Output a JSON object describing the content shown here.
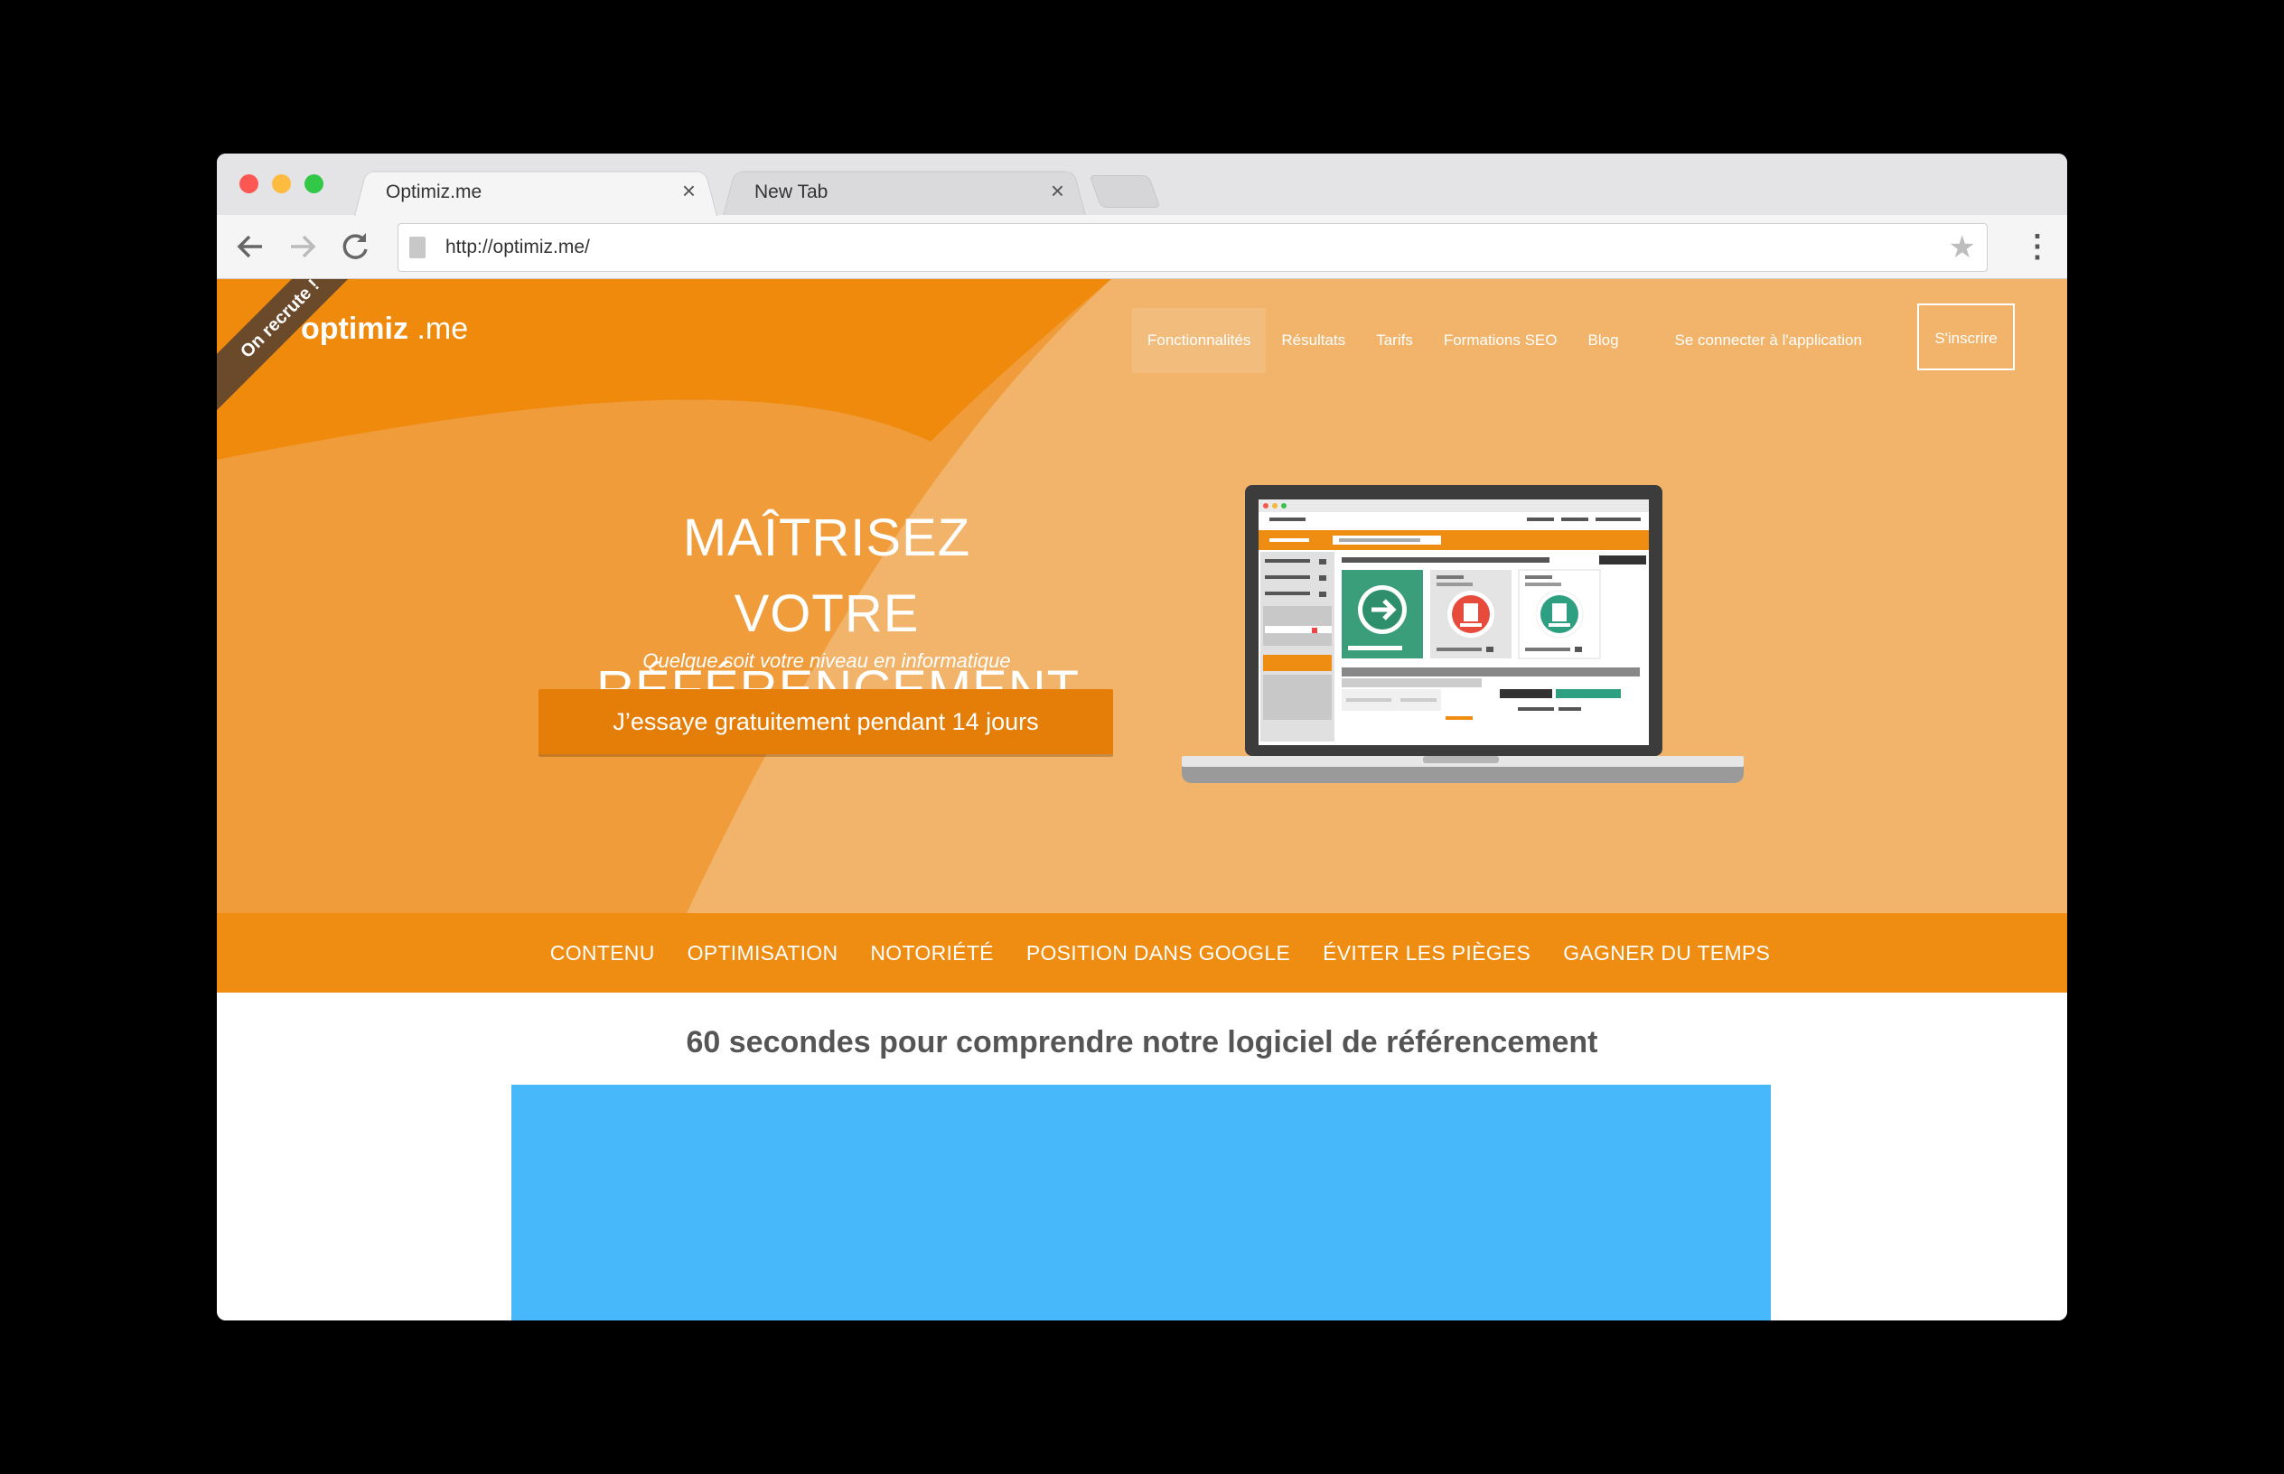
{
  "browser": {
    "tabs": [
      {
        "title": "Optimiz.me",
        "close": "×"
      },
      {
        "title": "New Tab",
        "close": "×"
      }
    ],
    "url": "http://optimiz.me/",
    "icons": {
      "back": "back-arrow-icon",
      "forward": "forward-arrow-icon",
      "reload": "reload-icon",
      "star": "bookmark-star-icon",
      "menu": "more-vert-icon"
    }
  },
  "site": {
    "ribbon": "On recrute !",
    "logo": {
      "word": "optimiz",
      "dot": ".",
      "suffix": "me"
    },
    "nav": [
      {
        "label": "Fonctionnalités",
        "active": true
      },
      {
        "label": "Résultats"
      },
      {
        "label": "Tarifs"
      },
      {
        "label": "Formations SEO"
      },
      {
        "label": "Blog"
      },
      {
        "label": "Se connecter à l'application"
      }
    ],
    "signup": "S'inscrire",
    "hero": {
      "title_line1": "MAÎTRISEZ VOTRE",
      "title_line2": "RÉFÉRENCEMENT",
      "subtitle": "Quelque soit votre niveau en informatique",
      "cta": "J’essaye gratuitement pendant 14 jours"
    },
    "features": [
      "CONTENU",
      "OPTIMISATION",
      "NOTORIÉTÉ",
      "POSITION DANS GOOGLE",
      "ÉVITER LES PIÈGES",
      "GAGNER DU TEMPS"
    ],
    "section_title": "60 secondes pour comprendre notre logiciel de référencement",
    "colors": {
      "orange": "#ef8c12",
      "hero_light": "#f1b46a",
      "cta": "#e47e08",
      "video": "#47b9fb"
    }
  }
}
